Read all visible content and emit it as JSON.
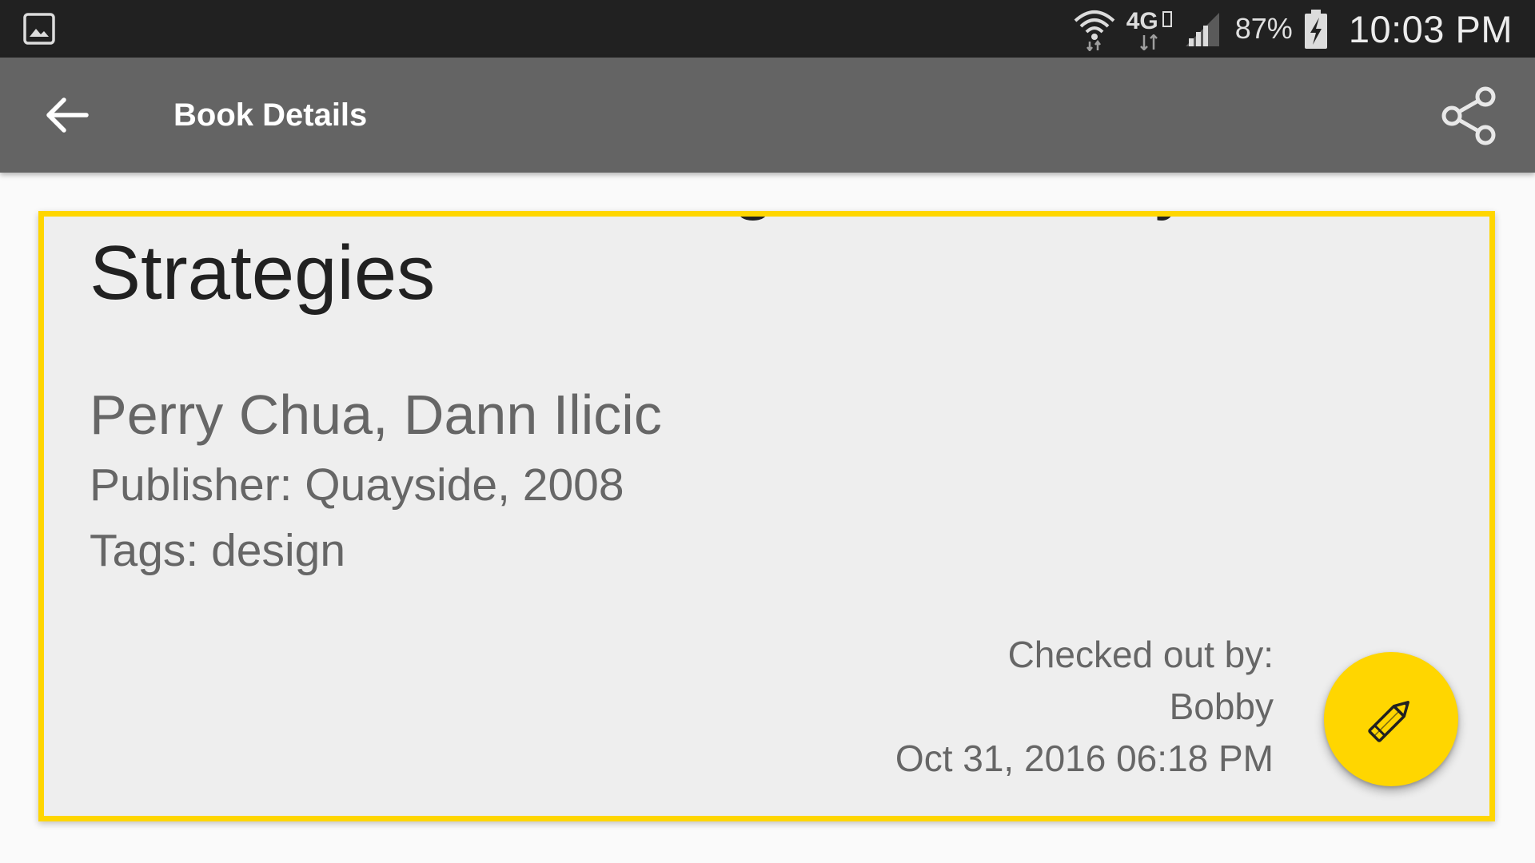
{
  "status_bar": {
    "icons": [
      "gallery-icon",
      "wifi-icon",
      "network-4g-lte-icon",
      "signal-icon",
      "battery-charging-icon"
    ],
    "network_label": "4G",
    "battery": "87%",
    "time": "10:03 PM"
  },
  "app_bar": {
    "title": "Book Details",
    "back_icon": "back-arrow-icon",
    "share_icon": "share-icon"
  },
  "book": {
    "title": "Share Their Naming and Identity Strategies",
    "authors": "Perry Chua, Dann Ilicic",
    "publisher": "Publisher: Quayside, 2008",
    "tags": "Tags: design"
  },
  "checkout": {
    "label": "Checked out by:",
    "name": "Bobby",
    "date": "Oct 31, 2016 06:18 PM"
  },
  "fab": {
    "icon": "pencil-icon"
  },
  "colors": {
    "status_bar": "#212121",
    "app_bar": "#646464",
    "accent": "#ffd600",
    "card_background": "#eeeeee",
    "page_background": "#fafafa",
    "secondary_text": "#666666",
    "primary_text": "#212121"
  }
}
